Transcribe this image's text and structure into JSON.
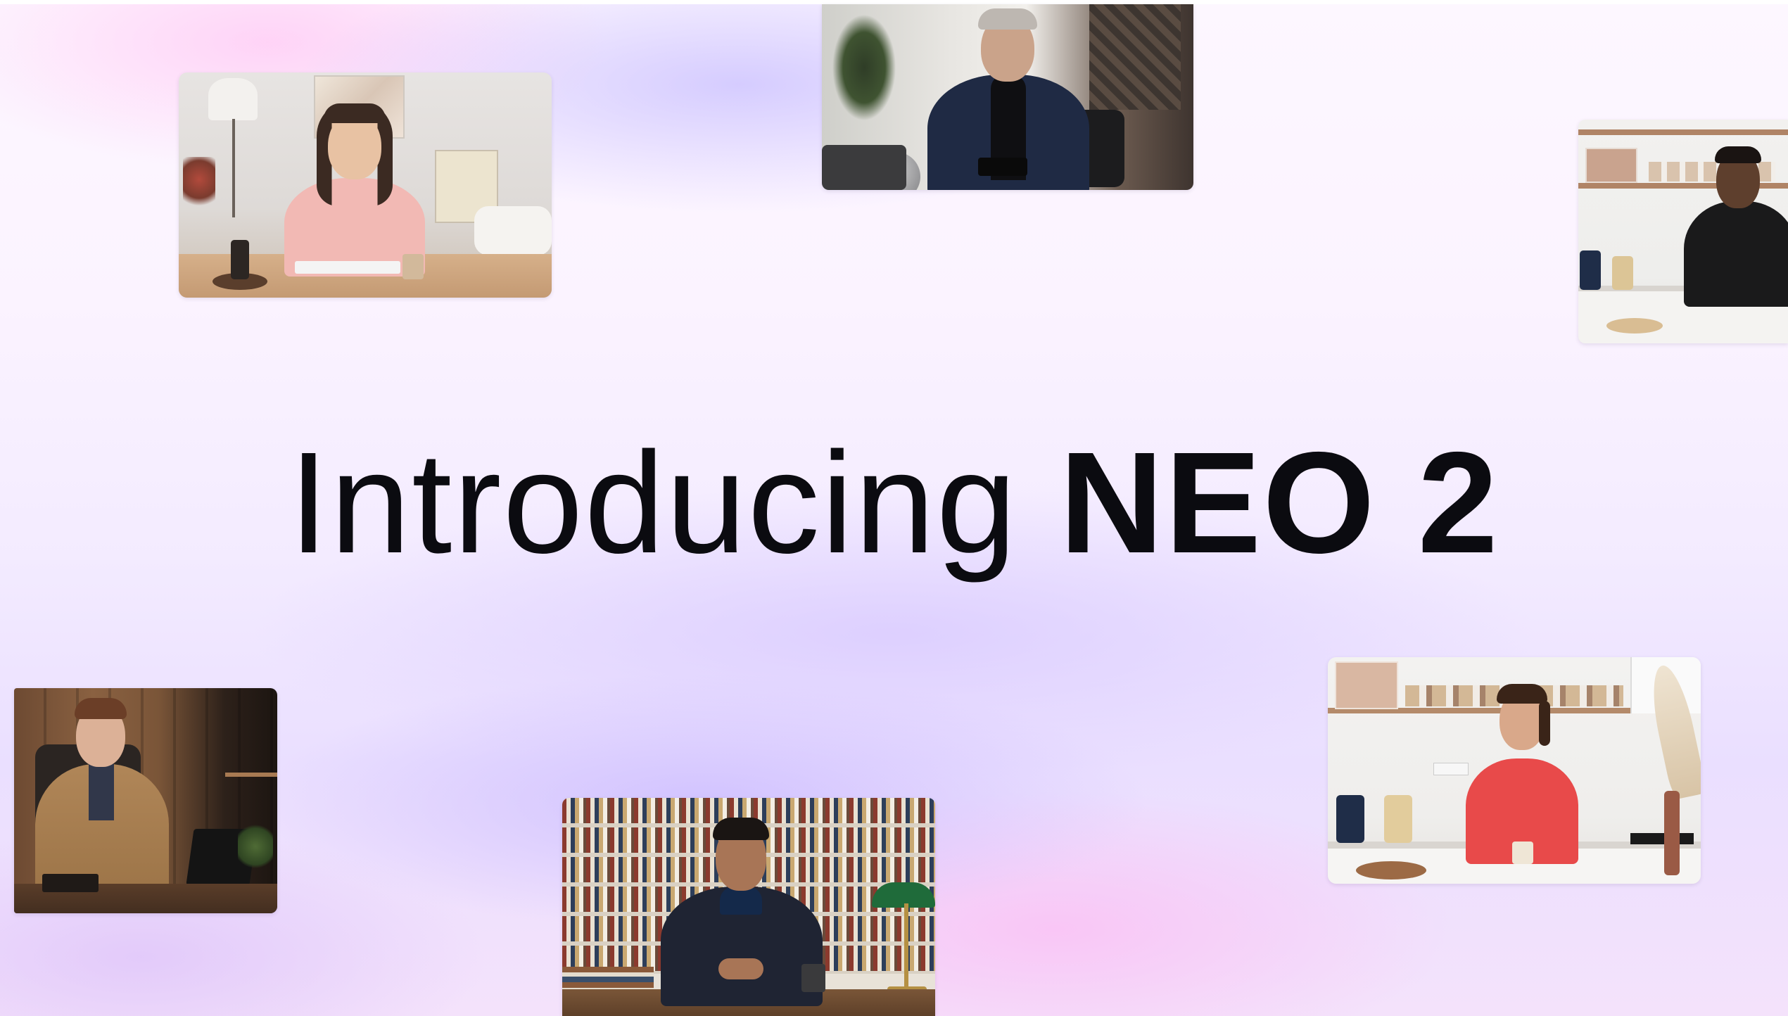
{
  "headline": {
    "intro": "Introducing",
    "product": "NEO 2"
  },
  "colors": {
    "text": "#0b0b10",
    "background_top": "#fdf7ff",
    "background_bottom": "#f4e2fb",
    "glow_lavender": "#d7c8ff",
    "glow_pink": "#fac3f5"
  },
  "avatar_cards": [
    {
      "id": "avatar-office-woman-pink"
    },
    {
      "id": "avatar-man-suit-tablet"
    },
    {
      "id": "avatar-man-kitchen-black-shirt"
    },
    {
      "id": "avatar-woman-tan-blazer"
    },
    {
      "id": "avatar-man-library"
    },
    {
      "id": "avatar-woman-kitchen-red-top"
    }
  ]
}
